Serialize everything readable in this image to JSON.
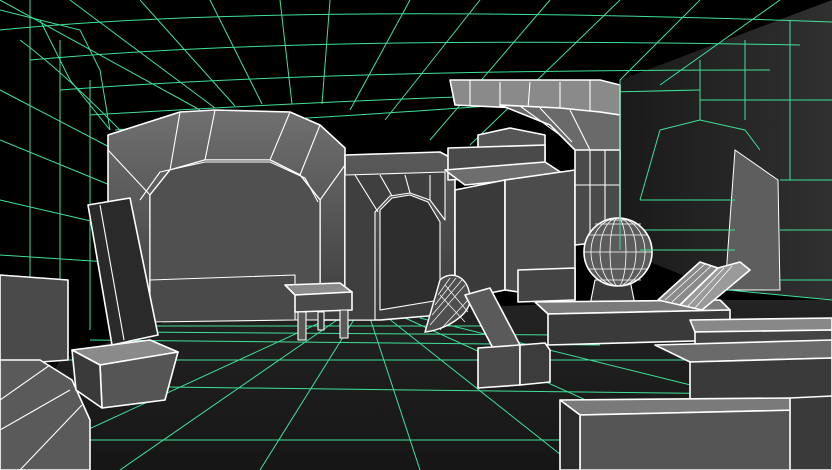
{
  "viewport": {
    "view": "3d-perspective-viewport",
    "shading": "flat-shaded-with-wireframe-on-shaded",
    "colors": {
      "background": "#000000",
      "grid_wire": "#3fe09a",
      "object_edges": "#ffffff",
      "floor": "#1e1e1e",
      "shade_dark": "#1a1a1a",
      "shade_mid": "#3a3a3a",
      "shade_light": "#5a5a5a",
      "shade_bright": "#6e6e6e"
    }
  }
}
